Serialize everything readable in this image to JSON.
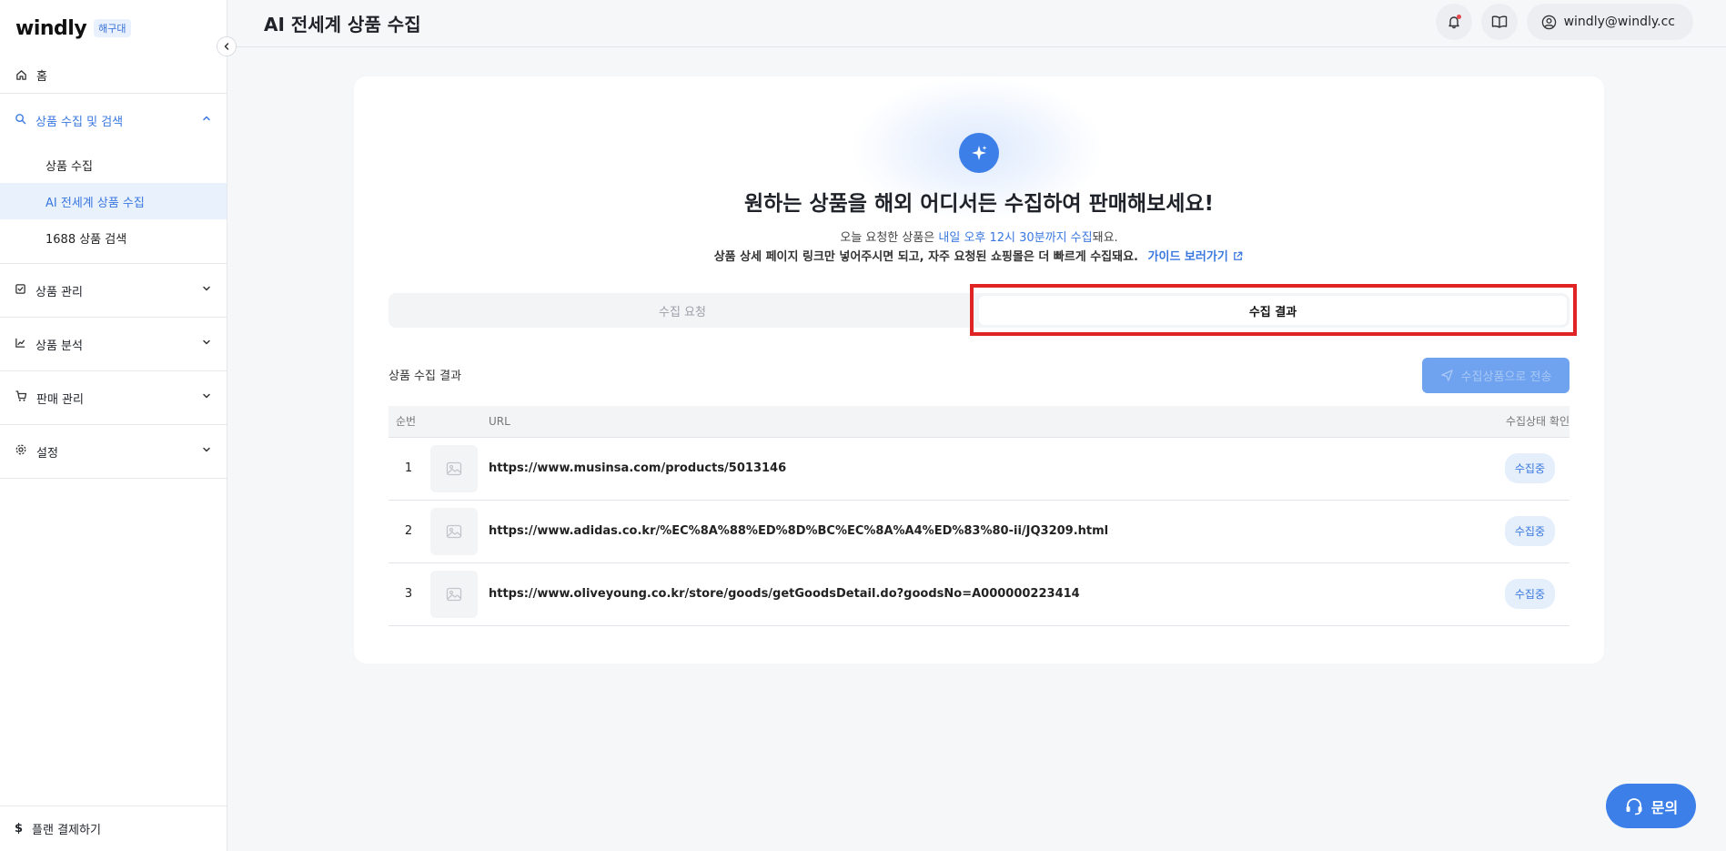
{
  "brand": {
    "logo": "windly",
    "badge": "해구대"
  },
  "sidebar": {
    "home_label": "홈",
    "collect_group": {
      "label": "상품 수집 및 검색",
      "items": [
        {
          "label": "상품 수집"
        },
        {
          "label": "AI 전세계 상품 수집",
          "active": true
        },
        {
          "label": "1688 상품 검색"
        }
      ]
    },
    "groups": [
      {
        "label": "상품 관리",
        "icon": "checklist-icon"
      },
      {
        "label": "상품 분석",
        "icon": "chart-icon"
      },
      {
        "label": "판매 관리",
        "icon": "cart-icon"
      },
      {
        "label": "설정",
        "icon": "gear-icon"
      }
    ],
    "bottom_label": "플랜 결제하기"
  },
  "header": {
    "title": "AI 전세계 상품 수집",
    "user_email": "windly@windly.cc"
  },
  "hero": {
    "title": "원하는 상품을 해외 어디서든 수집하여 판매해보세요!",
    "line1_prefix": "오늘 요청한 상품은 ",
    "line1_highlight": "내일 오후 12시 30분까지 수집",
    "line1_suffix": "돼요.",
    "line2": "상품 상세 페이지 링크만 넣어주시면 되고, 자주 요청된 쇼핑몰은 더 빠르게 수집돼요.",
    "guide_link": "가이드 보러가기"
  },
  "tabs": {
    "request": "수집 요청",
    "result": "수집 결과"
  },
  "results": {
    "section_title": "상품 수집 결과",
    "send_button": "수집상품으로 전송",
    "columns": {
      "no": "순번",
      "url": "URL",
      "status": "수집상태 확인"
    },
    "rows": [
      {
        "no": "1",
        "url": "https://www.musinsa.com/products/5013146",
        "status": "수집중"
      },
      {
        "no": "2",
        "url": "https://www.adidas.co.kr/%EC%8A%88%ED%8D%BC%EC%8A%A4%ED%83%80-ii/JQ3209.html",
        "status": "수집중"
      },
      {
        "no": "3",
        "url": "https://www.oliveyoung.co.kr/store/goods/getGoodsDetail.do?goodsNo=A000000223414",
        "status": "수집중"
      }
    ]
  },
  "fab": {
    "label": "문의"
  },
  "colors": {
    "accent": "#3c7fe8",
    "highlight_border": "#e02424",
    "status_bg": "#e5effc"
  }
}
